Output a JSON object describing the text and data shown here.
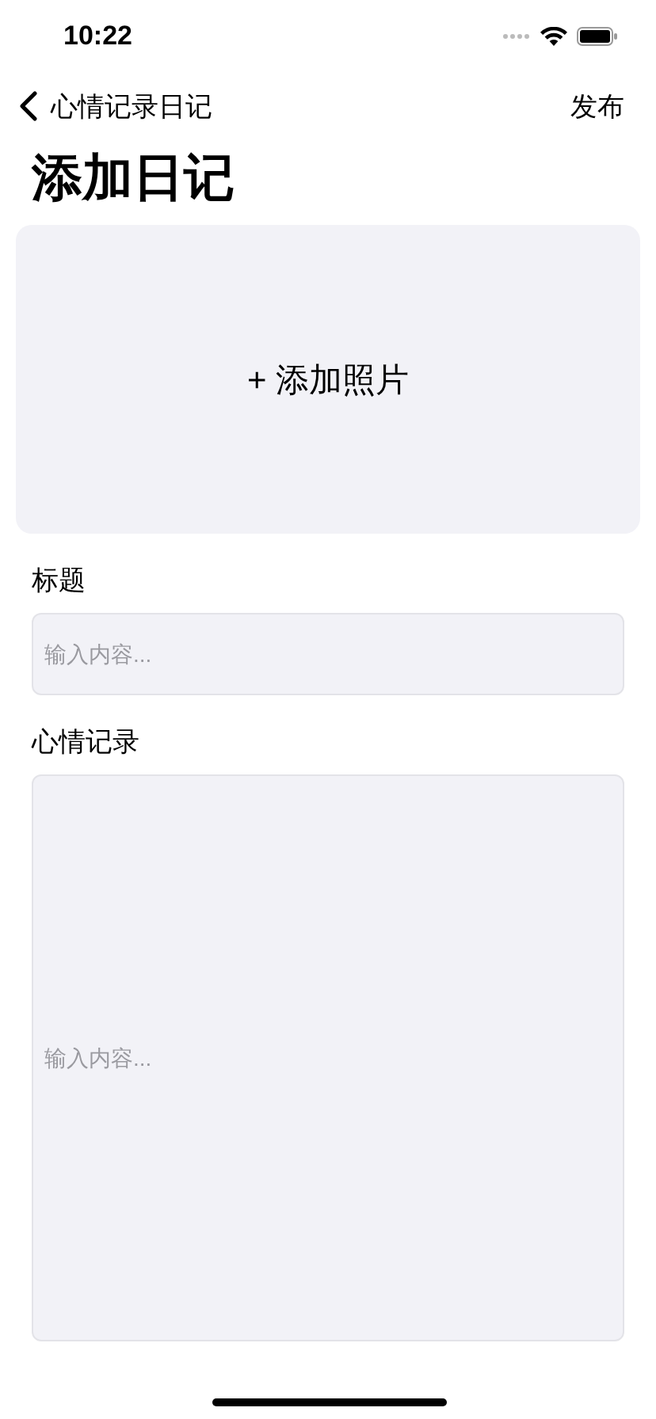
{
  "status_bar": {
    "time": "10:22"
  },
  "nav": {
    "back_label": "心情记录日记",
    "action": "发布"
  },
  "title": "添加日记",
  "photo": {
    "label": "+ 添加照片"
  },
  "fields": [
    {
      "label": "标题",
      "placeholder": "输入内容...",
      "kind": "line"
    },
    {
      "label": "心情记录",
      "placeholder": "输入内容...",
      "kind": "area"
    }
  ]
}
